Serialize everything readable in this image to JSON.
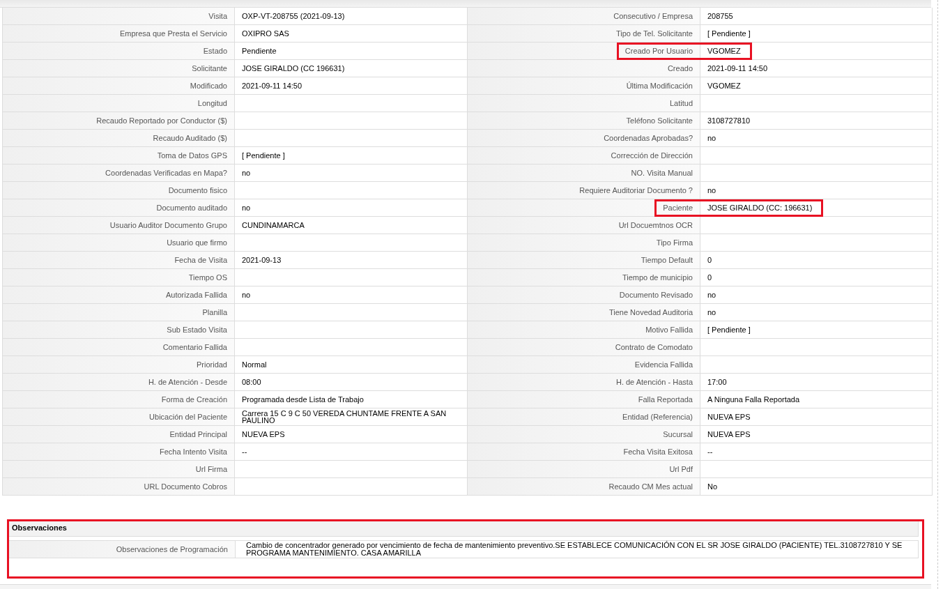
{
  "rows": [
    {
      "left": {
        "label": "Visita",
        "value": "OXP-VT-208755 (2021-09-13)"
      },
      "right": {
        "label": "Consecutivo / Empresa",
        "value": "208755",
        "highlighted": false
      }
    },
    {
      "left": {
        "label": "Empresa que Presta el Servicio",
        "value": "OXIPRO SAS"
      },
      "right": {
        "label": "Tipo de Tel. Solicitante",
        "value": "[ Pendiente ]",
        "highlighted": false
      }
    },
    {
      "left": {
        "label": "Estado",
        "value": "Pendiente"
      },
      "right": {
        "label": "Creado Por Usuario",
        "value": "VGOMEZ",
        "highlighted": true
      }
    },
    {
      "left": {
        "label": "Solicitante",
        "value": "JOSE GIRALDO (CC 196631)"
      },
      "right": {
        "label": "Creado",
        "value": "2021-09-11 14:50",
        "highlighted": false
      }
    },
    {
      "left": {
        "label": "Modificado",
        "value": "2021-09-11 14:50"
      },
      "right": {
        "label": "Última Modificación",
        "value": "VGOMEZ",
        "highlighted": false
      }
    },
    {
      "left": {
        "label": "Longitud"
      },
      "right": {
        "label": "Latitud",
        "highlighted": false
      }
    },
    {
      "left": {
        "label": "Recaudo Reportado por Conductor ($)"
      },
      "right": {
        "label": "Teléfono Solicitante",
        "value": "3108727810",
        "highlighted": false
      }
    },
    {
      "left": {
        "label": "Recaudo Auditado ($)"
      },
      "right": {
        "label": "Coordenadas Aprobadas?",
        "value": "no",
        "highlighted": false
      }
    },
    {
      "left": {
        "label": "Toma de Datos GPS",
        "value": "[ Pendiente ]"
      },
      "right": {
        "label": "Corrección de Dirección",
        "highlighted": false
      }
    },
    {
      "left": {
        "label": "Coordenadas Verificadas en Mapa?",
        "value": "no"
      },
      "right": {
        "label": "NO. Visita Manual",
        "highlighted": false
      }
    },
    {
      "left": {
        "label": "Documento fisico"
      },
      "right": {
        "label": "Requiere Auditoriar Documento ?",
        "value": "no",
        "highlighted": false
      }
    },
    {
      "left": {
        "label": "Documento auditado",
        "value": "no"
      },
      "right": {
        "label": "Paciente",
        "value": "JOSE GIRALDO (CC: 196631)",
        "highlighted": true
      }
    },
    {
      "left": {
        "label": "Usuario Auditor Documento Grupo",
        "value": "CUNDINAMARCA"
      },
      "right": {
        "label": "Url Docuemtnos OCR",
        "highlighted": false
      }
    },
    {
      "left": {
        "label": "Usuario que firmo"
      },
      "right": {
        "label": "Tipo Firma",
        "highlighted": false
      }
    },
    {
      "left": {
        "label": "Fecha de Visita",
        "value": "2021-09-13"
      },
      "right": {
        "label": "Tiempo Default",
        "value": "0",
        "highlighted": false
      }
    },
    {
      "left": {
        "label": "Tiempo OS"
      },
      "right": {
        "label": "Tiempo de municipio",
        "value": "0",
        "highlighted": false
      }
    },
    {
      "left": {
        "label": "Autorizada Fallida",
        "value": "no"
      },
      "right": {
        "label": "Documento Revisado",
        "value": "no",
        "highlighted": false
      }
    },
    {
      "left": {
        "label": "Planilla"
      },
      "right": {
        "label": "Tiene Novedad Auditoria",
        "value": "no",
        "highlighted": false
      }
    },
    {
      "left": {
        "label": "Sub Estado Visita"
      },
      "right": {
        "label": "Motivo Fallida",
        "value": "[ Pendiente ]",
        "highlighted": false
      }
    },
    {
      "left": {
        "label": "Comentario Fallida"
      },
      "right": {
        "label": "Contrato de Comodato",
        "highlighted": false
      }
    },
    {
      "left": {
        "label": "Prioridad",
        "value": "Normal"
      },
      "right": {
        "label": "Evidencia Fallida",
        "highlighted": false
      }
    },
    {
      "left": {
        "label": "H. de Atención - Desde",
        "value": "08:00"
      },
      "right": {
        "label": "H. de Atención - Hasta",
        "value": "17:00",
        "highlighted": false
      }
    },
    {
      "left": {
        "label": "Forma de Creación",
        "value": "Programada desde Lista de Trabajo"
      },
      "right": {
        "label": "Falla Reportada",
        "value": "A Ninguna Falla Reportada",
        "highlighted": false
      }
    },
    {
      "left": {
        "label": "Ubicación del Paciente",
        "value": "Carrera 15 C 9 C 50 VEREDA CHUNTAME FRENTE A SAN PAULINO"
      },
      "right": {
        "label": "Entidad (Referencia)",
        "value": "NUEVA EPS",
        "highlighted": false
      }
    },
    {
      "left": {
        "label": "Entidad Principal",
        "value": "NUEVA EPS"
      },
      "right": {
        "label": "Sucursal",
        "value": "NUEVA EPS",
        "highlighted": false
      }
    },
    {
      "left": {
        "label": "Fecha Intento Visita",
        "value": "--"
      },
      "right": {
        "label": "Fecha Visita Exitosa",
        "value": "--",
        "highlighted": false
      }
    },
    {
      "left": {
        "label": "Url Firma"
      },
      "right": {
        "label": "Url Pdf",
        "highlighted": false
      }
    },
    {
      "left": {
        "label": "URL Documento Cobros"
      },
      "right": {
        "label": "Recaudo CM Mes actual",
        "value": "No",
        "highlighted": false
      }
    }
  ],
  "observaciones": {
    "title": "Observaciones",
    "highlighted": true,
    "label": "Observaciones de Programación",
    "value": "Cambio de concentrador generado por vencimiento de fecha de mantenimiento preventivo.SE ESTABLECE COMUNICACIÓN CON EL SR JOSE GIRALDO (PACIENTE) TEL.3108727810 Y SE PROGRAMA MANTENIMIENTO. CASA AMARILLA"
  }
}
